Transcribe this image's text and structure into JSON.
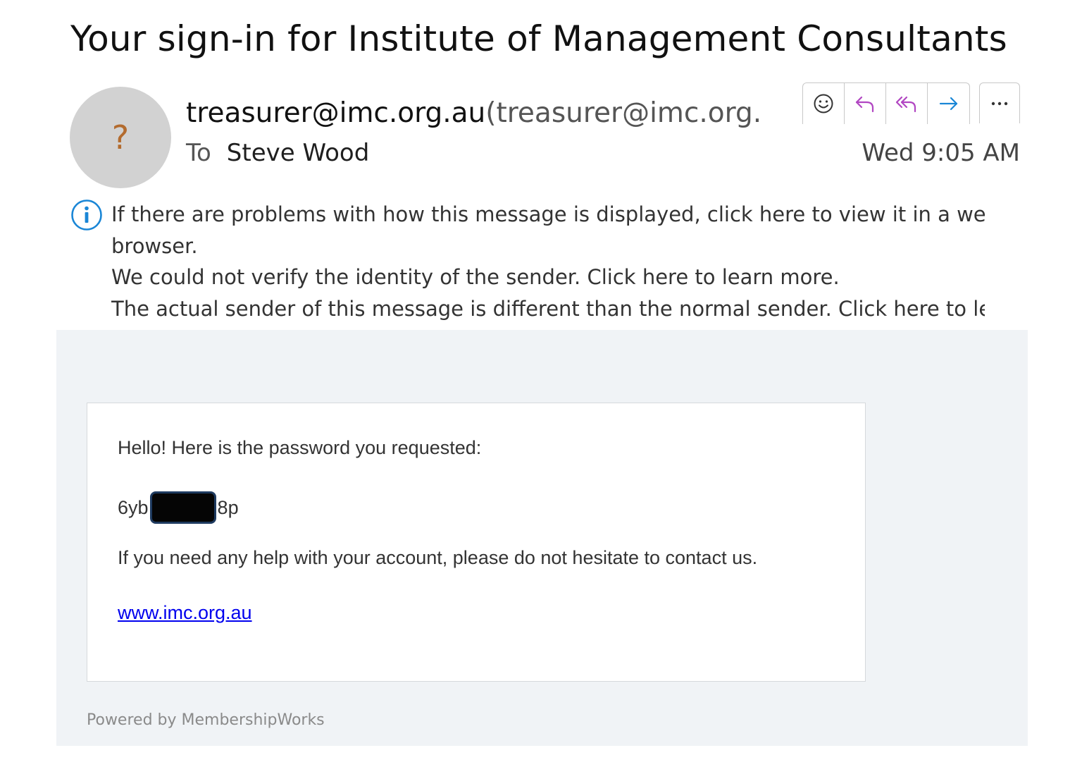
{
  "email": {
    "subject": "Your sign-in for Institute of Management Consultants",
    "avatar_glyph": "?",
    "sender_name": "treasurer@imc.org.au",
    "sender_address": "(treasurer@imc.org.",
    "to_label": "To",
    "to_name": "Steve Wood",
    "date": "Wed 9:05 AM",
    "actions": [
      "smiley-icon",
      "reply-icon",
      "reply-all-icon",
      "forward-icon",
      "more-icon"
    ]
  },
  "info": {
    "line1": "If there are problems with how this message is displayed, click here to view it in a web",
    "line2": "browser.",
    "line3": "We could not verify the identity of the sender. Click here to learn more.",
    "line4": "The actual sender of this message is different than the normal sender. Click here to learn"
  },
  "message": {
    "greeting": "Hello! Here is the password you requested:",
    "password_prefix": "6yb",
    "password_suffix": "8p",
    "help_text": "If you need any help with your account, please do not hesitate to contact us.",
    "link_text": "www.imc.org.au",
    "powered_by": "Powered by MembershipWorks"
  },
  "colors": {
    "accent_purple": "#b146c2",
    "accent_blue": "#1a86d6",
    "info_blue": "#1a86d6",
    "body_bg": "#f0f3f6",
    "link": "#0000ee"
  }
}
